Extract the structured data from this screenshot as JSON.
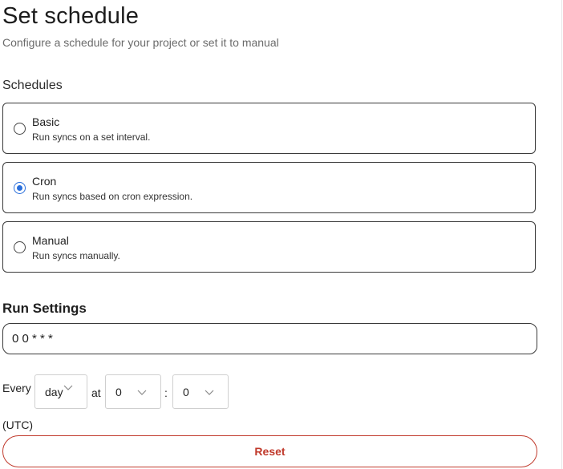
{
  "header": {
    "title": "Set schedule",
    "subtitle": "Configure a schedule for your project or set it to manual"
  },
  "schedules": {
    "label": "Schedules",
    "options": [
      {
        "title": "Basic",
        "description": "Run syncs on a set interval.",
        "selected": false
      },
      {
        "title": "Cron",
        "description": "Run syncs based on cron expression.",
        "selected": true
      },
      {
        "title": "Manual",
        "description": "Run syncs manually.",
        "selected": false
      }
    ]
  },
  "run_settings": {
    "title": "Run Settings",
    "cron_expression": "0 0 * * *",
    "every_label": "Every",
    "frequency_value": "day",
    "at_label": "at",
    "hour_value": "0",
    "colon": ":",
    "minute_value": "0",
    "timezone_label": "(UTC)",
    "reset_label": "Reset"
  },
  "colors": {
    "accent_radio": "#2a6fdb",
    "reset_red": "#c0392b",
    "border_dark": "#3a3a3a",
    "border_light": "#cfcfcf"
  },
  "icons": {
    "radio": "radio-button-icon",
    "dropdown": "chevron-down-icon"
  }
}
